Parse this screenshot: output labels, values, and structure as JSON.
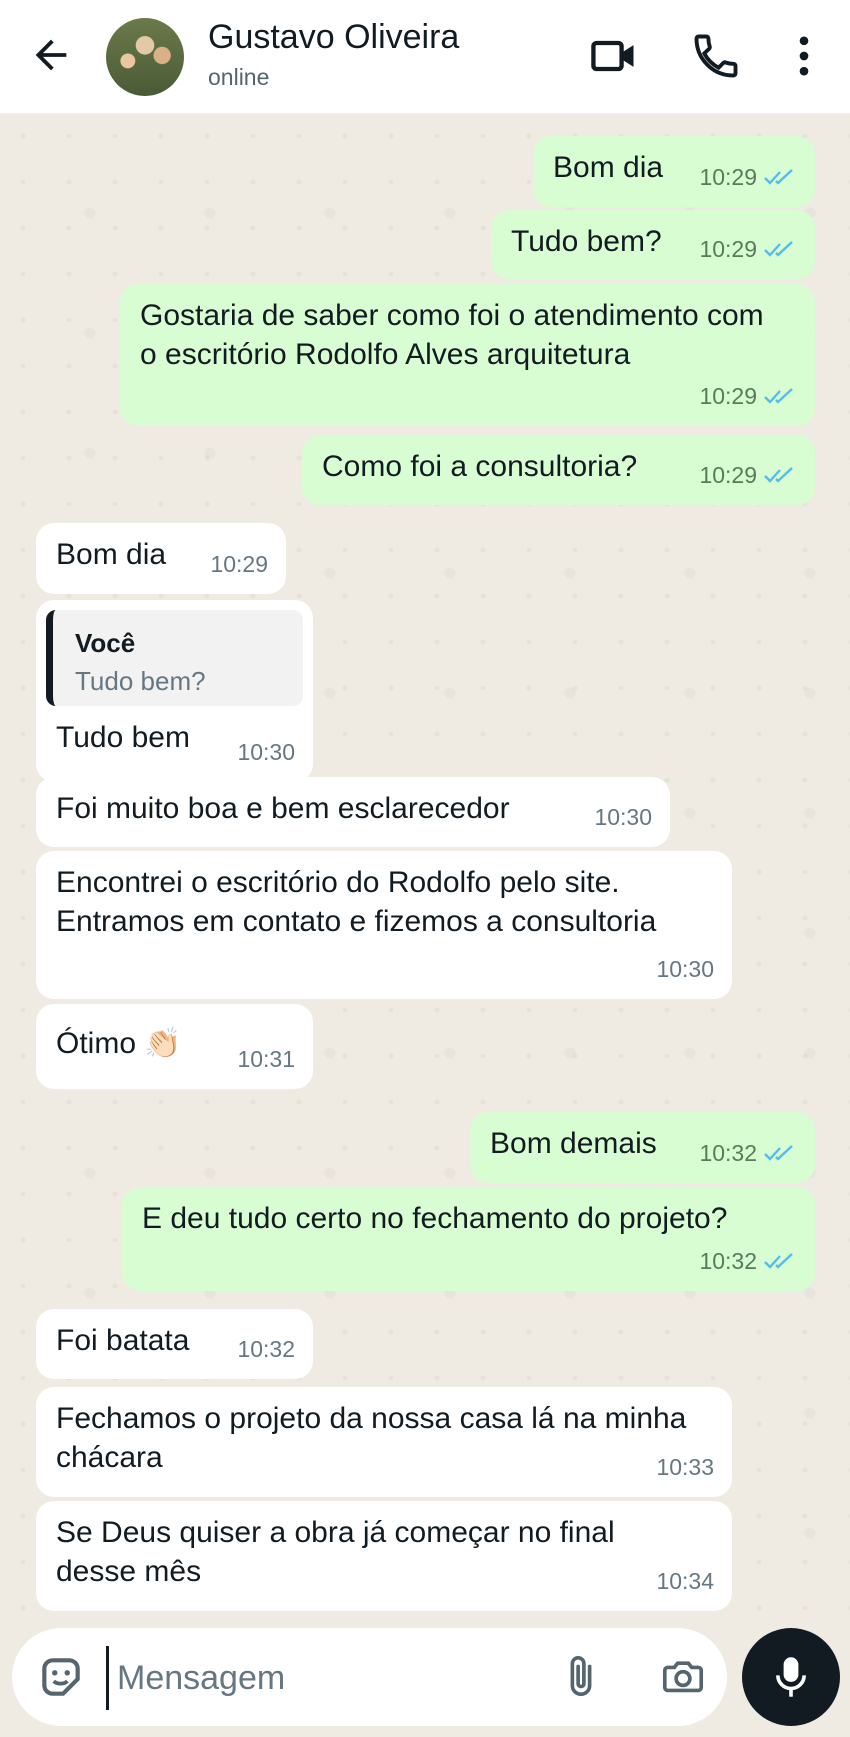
{
  "header": {
    "contact_name": "Gustavo Oliveira",
    "status": "online",
    "icons": [
      "back-arrow-icon",
      "video-call-icon",
      "phone-icon",
      "more-options-icon"
    ]
  },
  "messages": [
    {
      "direction": "out",
      "text": "Bom dia",
      "time": "10:29",
      "status": "read"
    },
    {
      "direction": "out",
      "text": "Tudo bem?",
      "time": "10:29",
      "status": "read"
    },
    {
      "direction": "out",
      "text": "Gostaria de saber como foi o atendimento com o escritório Rodolfo Alves arquitetura",
      "time": "10:29",
      "status": "read"
    },
    {
      "direction": "out",
      "text": "Como foi a consultoria?",
      "time": "10:29",
      "status": "read"
    },
    {
      "direction": "in",
      "text": "Bom dia",
      "time": "10:29"
    },
    {
      "direction": "in",
      "text": "Tudo bem",
      "time": "10:30",
      "quote": {
        "author": "Você",
        "text": "Tudo bem?"
      }
    },
    {
      "direction": "in",
      "text": "Foi muito boa e bem esclarecedor",
      "time": "10:30"
    },
    {
      "direction": "in",
      "text": "Encontrei o escritório do Rodolfo pelo site. Entramos em contato e fizemos a consultoria",
      "time": "10:30"
    },
    {
      "direction": "in",
      "text": "Ótimo 👏🏻",
      "time": "10:31"
    },
    {
      "direction": "out",
      "text": "Bom demais",
      "time": "10:32",
      "status": "read"
    },
    {
      "direction": "out",
      "text": "E deu tudo certo no fechamento do projeto?",
      "time": "10:32",
      "status": "read"
    },
    {
      "direction": "in",
      "text": "Foi batata",
      "time": "10:32"
    },
    {
      "direction": "in",
      "text": "Fechamos o projeto da nossa casa lá na minha chácara",
      "time": "10:33"
    },
    {
      "direction": "in",
      "text": "Se Deus quiser a obra já começar no final desse mês",
      "time": "10:34"
    }
  ],
  "input": {
    "placeholder": "Mensagem",
    "value": "",
    "icons": [
      "sticker-icon",
      "attach-icon",
      "camera-icon",
      "mic-icon"
    ]
  },
  "colors": {
    "outgoing_bubble": "#d9fdd3",
    "incoming_bubble": "#ffffff",
    "chat_background": "#efeae2",
    "read_ticks": "#53bdeb"
  }
}
